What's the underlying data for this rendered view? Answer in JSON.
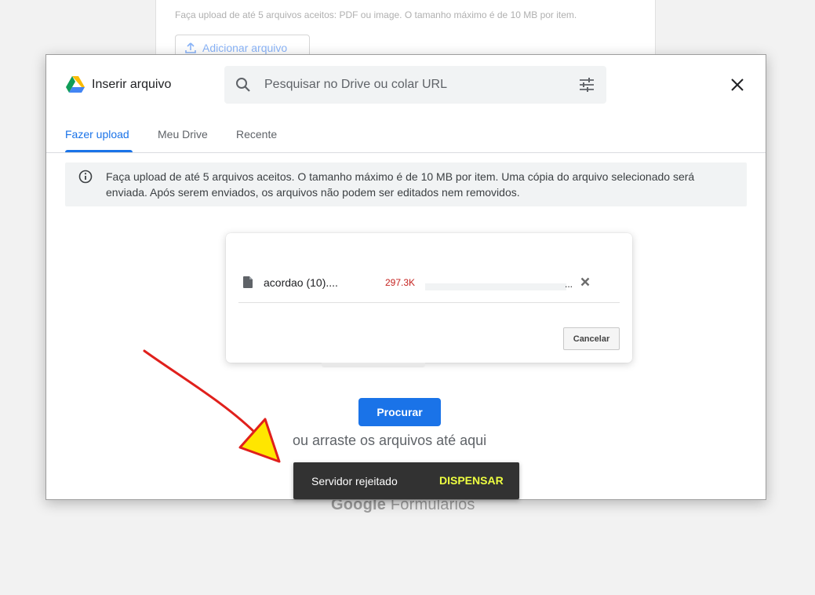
{
  "background_form": {
    "upload_hint": "Faça upload de até 5 arquivos aceitos: PDF ou image. O tamanho máximo é de 10 MB por item.",
    "add_file_label": "Adicionar arquivo",
    "footer_logo_brand": "Google",
    "footer_logo_product": "Formulários"
  },
  "dialog": {
    "title": "Inserir arquivo",
    "search": {
      "placeholder": "Pesquisar no Drive ou colar URL",
      "value": ""
    },
    "tabs": [
      {
        "label": "Fazer upload",
        "active": true
      },
      {
        "label": "Meu Drive",
        "active": false
      },
      {
        "label": "Recente",
        "active": false
      }
    ],
    "info_text": "Faça upload de até 5 arquivos aceitos. O tamanho máximo é de 10 MB por item. Uma cópia do arquivo selecionado será enviada. Após serem enviados, os arquivos não podem ser editados nem removidos.",
    "upload_item": {
      "file_name": "acordao (10)....",
      "file_size": "297.3K",
      "progress_suffix": "...",
      "progress_fraction": 0
    },
    "cancel_label": "Cancelar",
    "browse_label": "Procurar",
    "drag_hint": "ou arraste os arquivos até aqui"
  },
  "snackbar": {
    "message": "Servidor rejeitado",
    "action": "DISPENSAR"
  },
  "icons": {
    "drive": "google-drive-icon",
    "search": "search-icon",
    "filter": "tune-icon",
    "close": "close-icon",
    "info": "info-icon",
    "file": "file-icon",
    "upload": "upload-icon"
  },
  "colors": {
    "accent": "#1a73e8",
    "error_size": "#c5221f",
    "snackbar_bg": "#323232",
    "snackbar_action": "#eeff41",
    "annotation_arrow": "#e0201c",
    "annotation_fill": "#ffe600"
  }
}
